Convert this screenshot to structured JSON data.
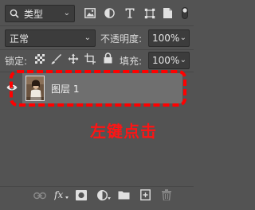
{
  "filter": {
    "kind_label": "类型",
    "filter_icons": [
      "image-filter-icon",
      "adjustment-filter-icon",
      "type-filter-icon",
      "shape-filter-icon",
      "smart-object-filter-icon"
    ]
  },
  "blend": {
    "mode": "正常",
    "opacity_label": "不透明度:",
    "opacity_value": "100%"
  },
  "lock": {
    "label": "锁定:",
    "fill_label": "填充:",
    "fill_value": "100%"
  },
  "layers": [
    {
      "name": "图层 1",
      "visible": true
    }
  ],
  "annotation": {
    "text": "左键点击",
    "color": "#ff1414"
  },
  "colors": {
    "panel_bg": "#535353",
    "selected_layer": "#6f6f6f",
    "highlight_border": "#ff0000"
  }
}
